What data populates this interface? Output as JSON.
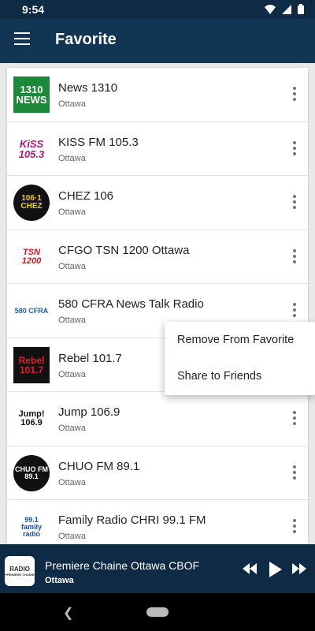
{
  "status": {
    "time": "9:54"
  },
  "appbar": {
    "title": "Favorite"
  },
  "stations": [
    {
      "name": "News 1310",
      "city": "Ottawa",
      "logo": "1310 NEWS"
    },
    {
      "name": "KISS FM 105.3",
      "city": "Ottawa",
      "logo": "KiSS 105.3"
    },
    {
      "name": "CHEZ 106",
      "city": "Ottawa",
      "logo": "106·1 CHEZ"
    },
    {
      "name": "CFGO TSN 1200 Ottawa",
      "city": "Ottawa",
      "logo": "TSN 1200"
    },
    {
      "name": "580 CFRA News Talk Radio",
      "city": "Ottawa",
      "logo": "580 CFRA"
    },
    {
      "name": "Rebel 101.7",
      "city": "Ottawa",
      "logo": "Rebel 101.7"
    },
    {
      "name": "Jump 106.9",
      "city": "Ottawa",
      "logo": "Jump! 106.9"
    },
    {
      "name": "CHUO FM 89.1",
      "city": "Ottawa",
      "logo": "CHUO FM 89.1"
    },
    {
      "name": "Family Radio CHRI 99.1 FM",
      "city": "Ottawa",
      "logo": "99.1 family radio"
    }
  ],
  "popup": {
    "remove": "Remove From Favorite",
    "share": "Share to Friends"
  },
  "player": {
    "title": "Premiere Chaine Ottawa CBOF",
    "city": "Ottawa",
    "logo_top": "RADIO",
    "logo_bottom": "PREMIÈRE CHAÎNE"
  },
  "colors": {
    "statusbar": "#0f2a45",
    "appbar": "#123553",
    "player": "#0f2a45"
  }
}
